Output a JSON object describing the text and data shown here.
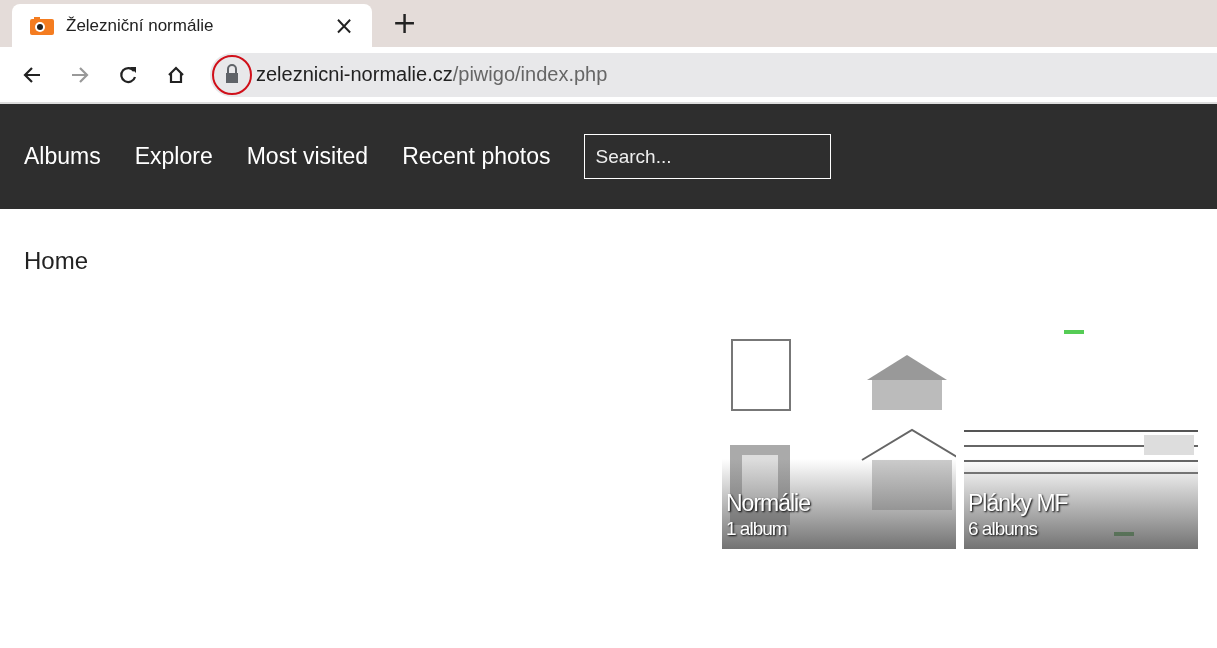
{
  "browser": {
    "tab": {
      "title": "Železniční normálie",
      "close": "×"
    },
    "new_tab": "+",
    "address": {
      "domain": "zeleznicni-normalie.cz",
      "path": "/piwigo/index.php"
    }
  },
  "nav": {
    "items": [
      {
        "label": "Albums"
      },
      {
        "label": "Explore"
      },
      {
        "label": "Most visited"
      },
      {
        "label": "Recent photos"
      }
    ],
    "search": {
      "placeholder": "Search..."
    }
  },
  "breadcrumb": "Home",
  "albums": [
    {
      "kind": "picture",
      "title": "Normálie",
      "count": "1 album"
    },
    {
      "kind": "picture",
      "title": "Plánky MF",
      "count": "6 albums"
    }
  ]
}
